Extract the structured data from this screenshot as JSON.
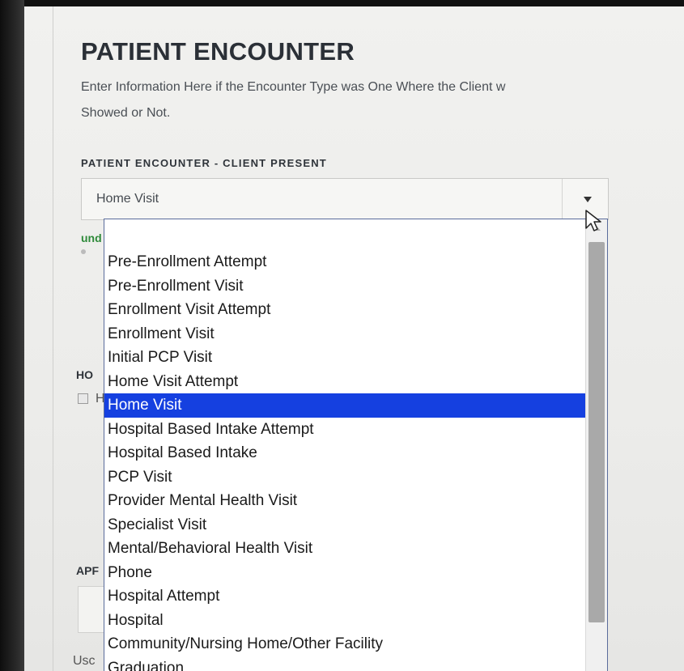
{
  "page": {
    "title": "PATIENT ENCOUNTER",
    "subtitle_line1": "Enter Information Here if the Encounter Type was One Where the Client w",
    "subtitle_line2": "Showed or Not."
  },
  "field": {
    "label": "PATIENT ENCOUNTER - CLIENT PRESENT",
    "selected_value": "Home Visit"
  },
  "background_fragments": {
    "und": "und",
    "ho": "HO",
    "h": "H",
    "apf": "APF",
    "usc": "Usc"
  },
  "dropdown": {
    "selected_index": 6,
    "options": [
      "Pre-Enrollment Attempt",
      "Pre-Enrollment Visit",
      "Enrollment Visit Attempt",
      "Enrollment Visit",
      "Initial PCP Visit",
      "Home Visit Attempt",
      "Home Visit",
      "Hospital Based Intake Attempt",
      "Hospital Based Intake",
      "PCP Visit",
      "Provider Mental Health Visit",
      "Specialist Visit",
      "Mental/Behavioral Health Visit",
      "Phone",
      "Hospital Attempt",
      "Hospital",
      "Community/Nursing Home/Other Facility",
      "Graduation"
    ]
  },
  "colors": {
    "selection": "#1540e0",
    "label_green": "#2e8a3a",
    "title": "#2b3037"
  },
  "icons": {
    "select_arrow": "chevron-down-icon",
    "cursor": "mouse-pointer-icon",
    "scroll_up": "scroll-up-icon"
  }
}
